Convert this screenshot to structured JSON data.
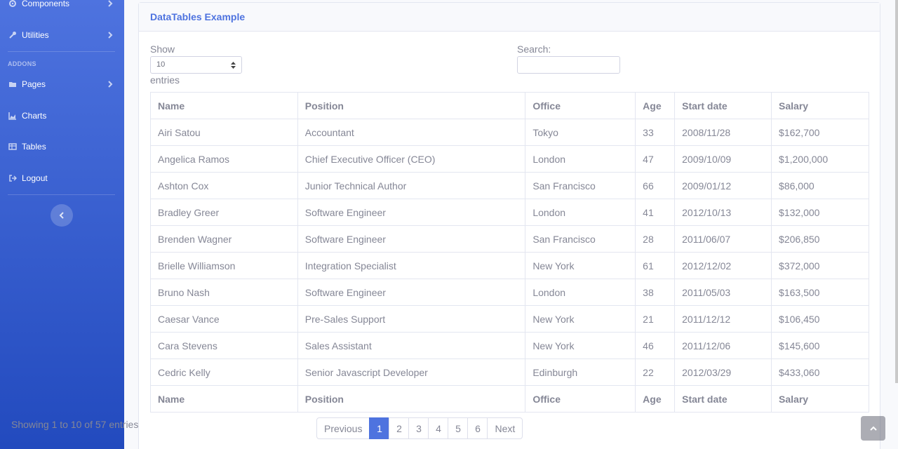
{
  "sidebar": {
    "items_top": [
      {
        "label": "Components",
        "icon": "cog-icon",
        "has_chevron": true
      },
      {
        "label": "Utilities",
        "icon": "wrench-icon",
        "has_chevron": true
      }
    ],
    "addons_heading": "ADDONS",
    "items_addons": [
      {
        "label": "Pages",
        "icon": "folder-icon",
        "has_chevron": true
      },
      {
        "label": "Charts",
        "icon": "area-chart-icon",
        "has_chevron": false
      },
      {
        "label": "Tables",
        "icon": "table-icon",
        "has_chevron": false
      },
      {
        "label": "Logout",
        "icon": "sign-out-icon",
        "has_chevron": false
      }
    ]
  },
  "card": {
    "title": "DataTables Example",
    "show_label": "Show",
    "length_value": "10",
    "entries_label": "entries",
    "search_label": "Search:",
    "search_value": ""
  },
  "table": {
    "columns": [
      "Name",
      "Position",
      "Office",
      "Age",
      "Start date",
      "Salary"
    ],
    "rows": [
      [
        "Airi Satou",
        "Accountant",
        "Tokyo",
        "33",
        "2008/11/28",
        "$162,700"
      ],
      [
        "Angelica Ramos",
        "Chief Executive Officer (CEO)",
        "London",
        "47",
        "2009/10/09",
        "$1,200,000"
      ],
      [
        "Ashton Cox",
        "Junior Technical Author",
        "San Francisco",
        "66",
        "2009/01/12",
        "$86,000"
      ],
      [
        "Bradley Greer",
        "Software Engineer",
        "London",
        "41",
        "2012/10/13",
        "$132,000"
      ],
      [
        "Brenden Wagner",
        "Software Engineer",
        "San Francisco",
        "28",
        "2011/06/07",
        "$206,850"
      ],
      [
        "Brielle Williamson",
        "Integration Specialist",
        "New York",
        "61",
        "2012/12/02",
        "$372,000"
      ],
      [
        "Bruno Nash",
        "Software Engineer",
        "London",
        "38",
        "2011/05/03",
        "$163,500"
      ],
      [
        "Caesar Vance",
        "Pre-Sales Support",
        "New York",
        "21",
        "2011/12/12",
        "$106,450"
      ],
      [
        "Cara Stevens",
        "Sales Assistant",
        "New York",
        "46",
        "2011/12/06",
        "$145,600"
      ],
      [
        "Cedric Kelly",
        "Senior Javascript Developer",
        "Edinburgh",
        "22",
        "2012/03/29",
        "$433,060"
      ]
    ]
  },
  "footer": {
    "info": "Showing 1 to 10 of 57 entries",
    "previous": "Previous",
    "next": "Next",
    "pages": [
      "1",
      "2",
      "3",
      "4",
      "5",
      "6"
    ],
    "active_page": "1"
  },
  "colors": {
    "primary": "#4e73df",
    "sidebar_gradient_end": "#224abe",
    "text_muted": "#858796"
  }
}
